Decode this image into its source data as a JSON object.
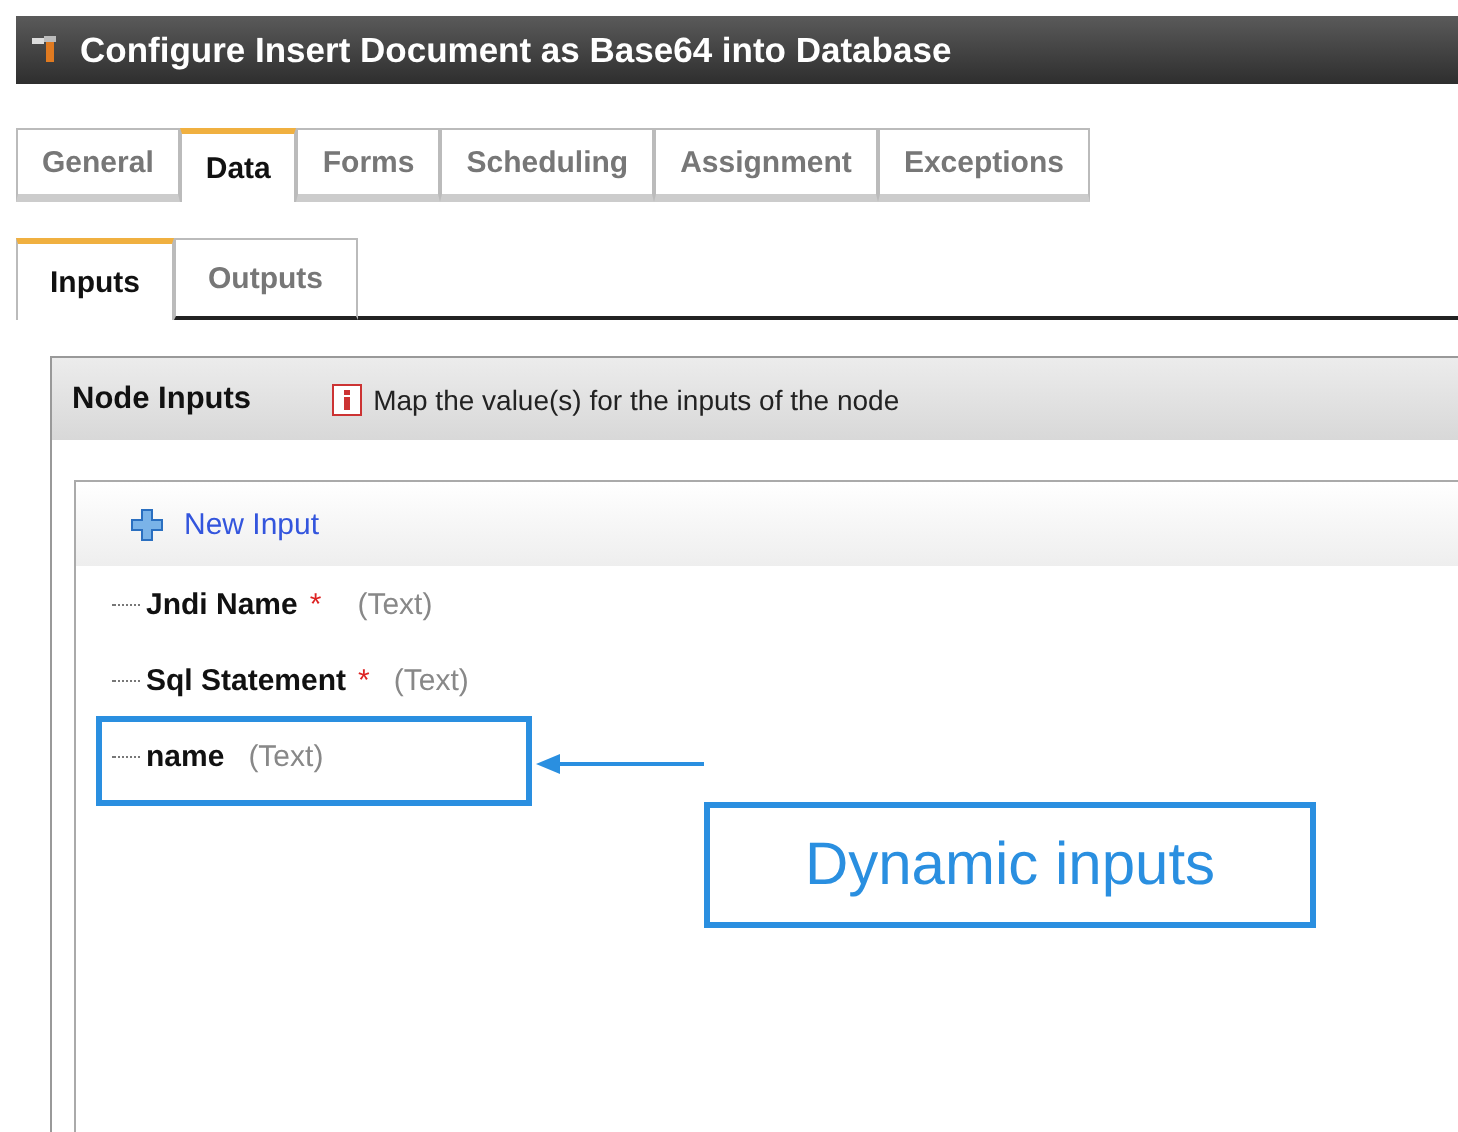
{
  "window": {
    "title": "Configure Insert Document as Base64 into Database"
  },
  "tabs": [
    {
      "label": "General",
      "selected": false
    },
    {
      "label": "Data",
      "selected": true
    },
    {
      "label": "Forms",
      "selected": false
    },
    {
      "label": "Scheduling",
      "selected": false
    },
    {
      "label": "Assignment",
      "selected": false
    },
    {
      "label": "Exceptions",
      "selected": false
    }
  ],
  "subtabs": [
    {
      "label": "Inputs",
      "selected": true
    },
    {
      "label": "Outputs",
      "selected": false
    }
  ],
  "panel": {
    "title": "Node Inputs",
    "hint": "Map the value(s) for the inputs of the node",
    "new_input": "New Input",
    "inputs": [
      {
        "name": "Jndi Name",
        "required_mark": "*",
        "type": "(Text)"
      },
      {
        "name": "Sql Statement",
        "required_mark": "*",
        "type": "(Text)"
      },
      {
        "name": "name",
        "type": "(Text)"
      }
    ]
  },
  "callout": {
    "text": "Dynamic inputs"
  }
}
